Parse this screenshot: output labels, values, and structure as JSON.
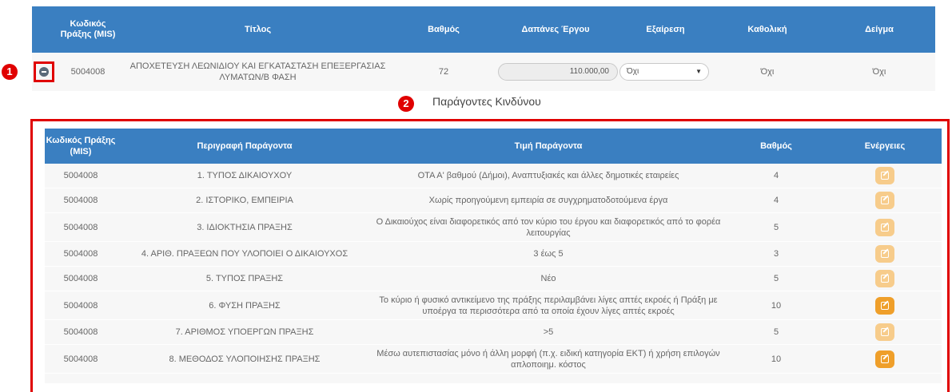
{
  "markers": {
    "one": "1",
    "two": "2"
  },
  "operation_table": {
    "headers": {
      "mis": "Κωδικός Πράξης (MIS)",
      "title": "Τίτλος",
      "grade": "Βαθμός",
      "cost": "Δαπάνες Έργου",
      "exclusion": "Εξαίρεση",
      "universal": "Καθολική",
      "sample": "Δείγμα"
    },
    "row": {
      "mis": "5004008",
      "title": "ΑΠΟΧΕΤΕΥΣΗ ΛΕΩΝΙΔΙΟΥ ΚΑΙ ΕΓΚΑΤΑΣΤΑΣΗ ΕΠΕΞΕΡΓΑΣΙΑΣ ΛΥΜΑΤΩΝ/Β ΦΑΣΗ",
      "grade": "72",
      "cost": "110.000,00",
      "exclusion": "Όχι",
      "universal": "Όχι",
      "sample": "Όχι"
    }
  },
  "risk_section": {
    "title": "Παράγοντες Κινδύνου",
    "headers": {
      "mis": "Κωδικός Πράξης (MIS)",
      "description": "Περιγραφή Παράγοντα",
      "value": "Τιμή Παράγοντα",
      "grade": "Βαθμός",
      "actions": "Ενέργειες"
    },
    "rows": [
      {
        "mis": "5004008",
        "description": "1. ΤΥΠΟΣ ΔΙΚΑΙΟΥΧΟΥ",
        "value": "ΟΤΑ Α' βαθμού (Δήμοι), Αναπτυξιακές και άλλες δημοτικές εταιρείες",
        "grade": "4"
      },
      {
        "mis": "5004008",
        "description": "2. ΙΣΤΟΡΙΚΟ, ΕΜΠΕΙΡΙΑ",
        "value": "Χωρίς προηγούμενη εμπειρία σε συγχρηματοδοτούμενα έργα",
        "grade": "4"
      },
      {
        "mis": "5004008",
        "description": "3. ΙΔΙΟΚΤΗΣΙΑ ΠΡΑΞΗΣ",
        "value": "Ο Δικαιούχος είναι διαφορετικός από τον κύριο του έργου και διαφορετικός από το φορέα λειτουργίας",
        "grade": "5"
      },
      {
        "mis": "5004008",
        "description": "4. ΑΡΙΘ. ΠΡΑΞΕΩΝ ΠΟΥ ΥΛΟΠΟΙΕΙ Ο ΔΙΚΑΙΟΥΧΟΣ",
        "value": "3 έως 5",
        "grade": "3"
      },
      {
        "mis": "5004008",
        "description": "5. ΤΥΠΟΣ ΠΡΑΞΗΣ",
        "value": "Νέο",
        "grade": "5"
      },
      {
        "mis": "5004008",
        "description": "6. ΦΥΣΗ ΠΡΑΞΗΣ",
        "value": "Το κύριο ή φυσικό αντικείμενο της πράξης περιλαμβάνει λίγες απτές εκροές ή Πράξη με υποέργα τα περισσότερα από τα οποία έχουν λίγες απτές εκροές",
        "grade": "10"
      },
      {
        "mis": "5004008",
        "description": "7. ΑΡΙΘΜΟΣ ΥΠΟΕΡΓΩΝ ΠΡΑΞΗΣ",
        "value": ">5",
        "grade": "5"
      },
      {
        "mis": "5004008",
        "description": "8. ΜΕΘΟΔΟΣ ΥΛΟΠΟΙΗΣΗΣ ΠΡΑΞΗΣ",
        "value": "Μέσω αυτεπιστασίας μόνο ή άλλη μορφή (π.χ. ειδική κατηγορία ΕΚΤ) ή χρήση επιλογών απλοποιημ. κόστος",
        "grade": "10"
      }
    ]
  },
  "colors": {
    "header": "#3a7fc1",
    "highlight": "#e00000",
    "edit_light": "#f7cc8b",
    "edit_dark": "#ef9f2a"
  }
}
